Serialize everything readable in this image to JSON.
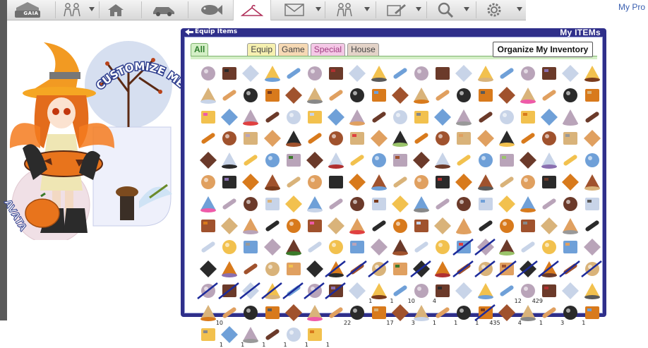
{
  "nav": {
    "logo_text": "GAIA",
    "tabs": [
      {
        "icon": "gaia-logo-icon"
      },
      {
        "icon": "friends-icon"
      },
      {
        "icon": "house-icon"
      },
      {
        "icon": "car-icon"
      },
      {
        "icon": "fish-icon"
      },
      {
        "icon": "hanger-icon",
        "selected": true
      },
      {
        "icon": "mail-icon"
      },
      {
        "icon": "community-icon"
      },
      {
        "icon": "pencil-icon"
      },
      {
        "icon": "search-icon"
      },
      {
        "icon": "gear-icon"
      }
    ],
    "profile_link": "My Pro"
  },
  "avatar": {
    "banner_text": "CUSTOMIZE ME",
    "side_text": "AVATA"
  },
  "inventory": {
    "title_left": "Equip Items",
    "title_right": "My ITEMs",
    "tabs": [
      "All",
      "Equip",
      "Game",
      "Special",
      "House"
    ],
    "organize_label": "Organize My Inventory",
    "quantities": {
      "r10c7": "1",
      "r10c8": "1",
      "r10c9": "10",
      "r10c10": "4",
      "r10c14": "12",
      "r10c15": "429",
      "r11c0": "10",
      "r11c6": "22",
      "r11c8": "17",
      "r11c9": "3",
      "r11c10": "1",
      "r11c11": "1",
      "r11c12": "1",
      "r11c13": "435",
      "r11c14": "4",
      "r11c15": "1",
      "r11c16": "3",
      "r11c17": "1",
      "r12c0": "1",
      "r12c1": "1",
      "r12c2": "1",
      "r12c3": "1",
      "r12c4": "1",
      "r12c5": "1"
    }
  },
  "colors": {
    "panel": "#2f2f8a",
    "accent_pink": "#ee5aa8",
    "crossout": "#1c2a9a"
  }
}
